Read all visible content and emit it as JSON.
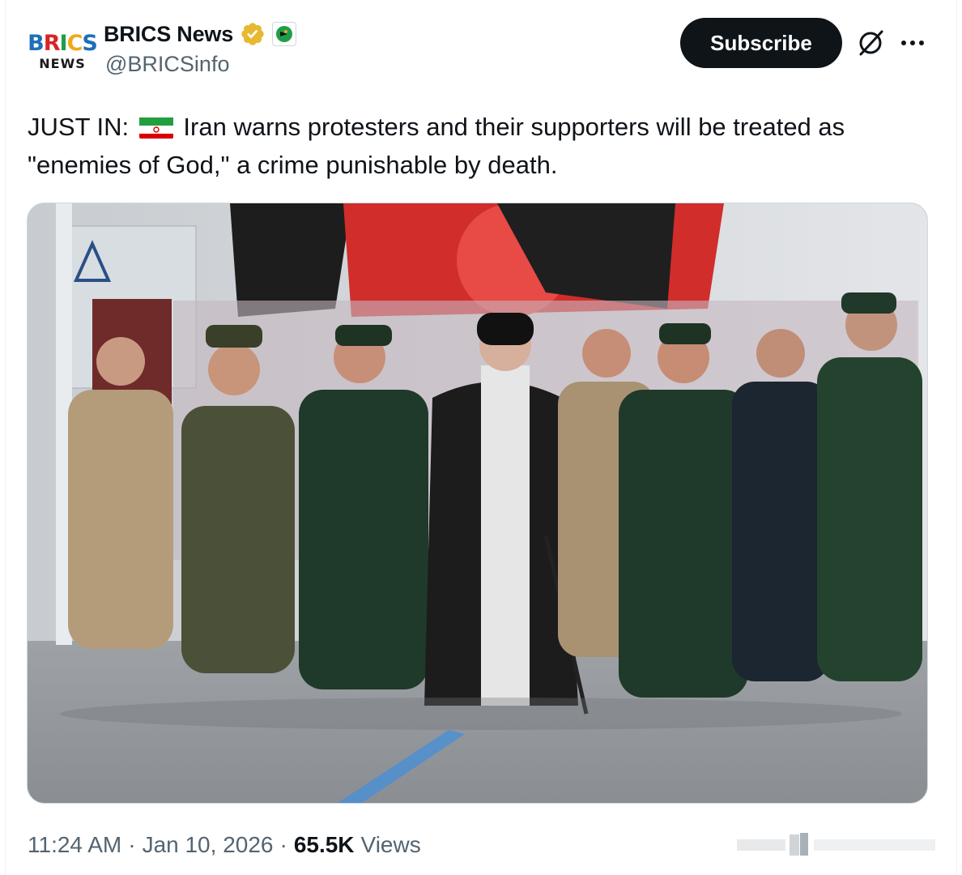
{
  "account": {
    "avatar_top": "BRICS",
    "avatar_bottom": "NEWS",
    "display_name": "BRICS News",
    "handle": "@BRICSinfo"
  },
  "actions": {
    "subscribe_label": "Subscribe"
  },
  "tweet": {
    "text_lead": "JUST IN:",
    "text_body": "Iran warns protesters and their supporters will be treated as \"enemies of God,\" a crime punishable by death."
  },
  "meta": {
    "time": "11:24 AM",
    "date": "Jan 10, 2026",
    "views_count": "65.5K",
    "views_label": "Views"
  },
  "icons": {
    "verified": "verified-gold-badge-icon",
    "affiliate": "affiliate-badge-icon",
    "grok": "grok-icon",
    "more": "more-dots-icon"
  },
  "colors": {
    "subscribe_bg": "#0f1419",
    "verified_gold": "#e8b830",
    "secondary_text": "#536471"
  }
}
